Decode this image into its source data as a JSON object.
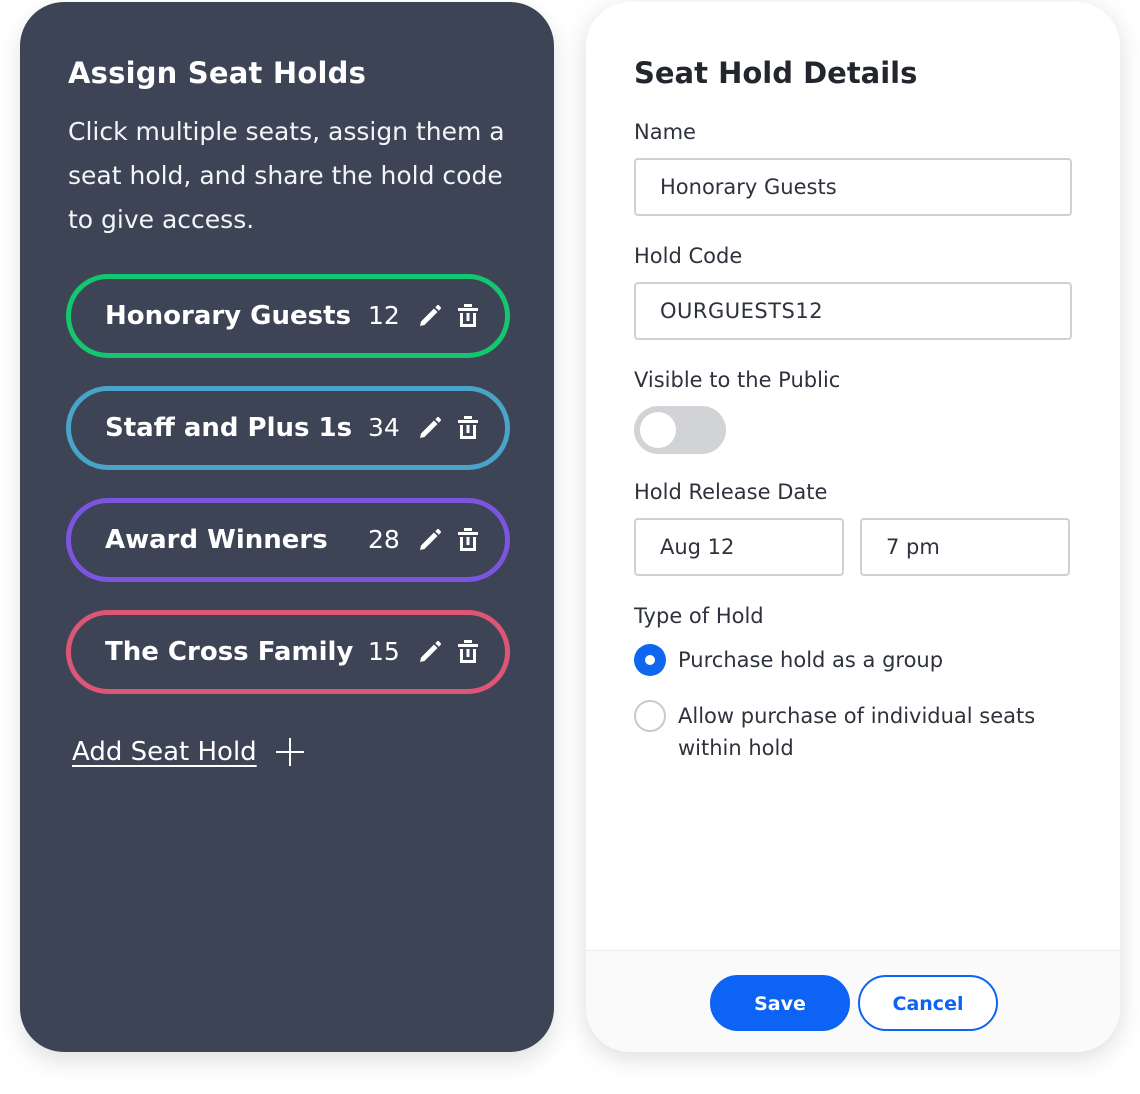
{
  "left_panel": {
    "title": "Assign Seat Holds",
    "description": "Click multiple seats, assign them a seat hold, and share the hold code to give access.",
    "holds": [
      {
        "name": "Honorary Guests",
        "count": "12",
        "color": "#12c76f"
      },
      {
        "name": "Staff and Plus 1s",
        "count": "34",
        "color": "#4aa3c8"
      },
      {
        "name": "Award Winners",
        "count": "28",
        "color": "#7b55e0"
      },
      {
        "name": "The Cross Family",
        "count": "15",
        "color": "#de5676"
      }
    ],
    "add_label": "Add Seat Hold",
    "edit_icon": "pencil-icon",
    "delete_icon": "trash-icon",
    "add_icon": "plus-icon"
  },
  "details": {
    "title": "Seat Hold Details",
    "name_label": "Name",
    "name_value": "Honorary Guests",
    "code_label": "Hold Code",
    "code_value": "OURGUESTS12",
    "visible_label": "Visible to the Public",
    "visible_on": false,
    "release_label": "Hold Release Date",
    "release_date": "Aug 12",
    "release_time": "7 pm",
    "type_label": "Type of Hold",
    "options": [
      {
        "label": "Purchase hold as a group",
        "selected": true
      },
      {
        "label": "Allow purchase of individual seats within hold",
        "selected": false
      }
    ],
    "save_label": "Save",
    "cancel_label": "Cancel"
  },
  "colors": {
    "panel_dark": "#3d4456",
    "primary": "#0d63f3",
    "toggle_off": "#d1d3d7"
  }
}
